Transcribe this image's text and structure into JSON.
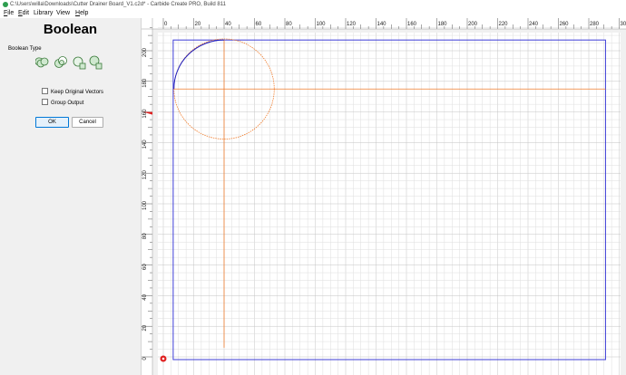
{
  "window": {
    "title": "C:\\Users\\willa\\Downloads\\Cutter Drainer Board_V1.c2d* - Carbide Create PRO, Build 811"
  },
  "menu": [
    {
      "label": "File",
      "mnemonic": "F",
      "rest": "ile"
    },
    {
      "label": "Edit",
      "mnemonic": "E",
      "rest": "dit"
    },
    {
      "label": "Library",
      "mnemonic": "",
      "rest": "Library"
    },
    {
      "label": "View",
      "mnemonic": "",
      "rest": "View"
    },
    {
      "label": "Help",
      "mnemonic": "H",
      "rest": "elp"
    }
  ],
  "panel": {
    "title": "Boolean",
    "type_label": "Boolean Type",
    "boolean_types": [
      {
        "name": "union",
        "icon": "union-icon"
      },
      {
        "name": "subtract",
        "icon": "subtract-icon"
      },
      {
        "name": "intersect",
        "icon": "intersect-icon"
      },
      {
        "name": "weld",
        "icon": "weld-icon"
      }
    ],
    "keep_original_label": "Keep Original Vectors",
    "keep_original_checked": false,
    "group_output_label": "Group Output",
    "group_output_checked": false,
    "ok_label": "OK",
    "cancel_label": "Cancel"
  },
  "ruler": {
    "x_labels": [
      "0",
      "20",
      "40",
      "60",
      "80",
      "100",
      "120",
      "140",
      "160",
      "180",
      "200",
      "220",
      "240",
      "260",
      "280",
      "300"
    ],
    "y_labels": [
      "0",
      "20",
      "40",
      "60",
      "80",
      "100",
      "120",
      "140",
      "160",
      "180",
      "200"
    ]
  },
  "colors": {
    "stock_outline": "#3d3dd6",
    "selected_vectors": "#f07c2c",
    "arc": "#1f1fbf",
    "grid_minor": "#dedede",
    "grid_major": "#c4c4c4",
    "origin_marker": "#e02020"
  }
}
